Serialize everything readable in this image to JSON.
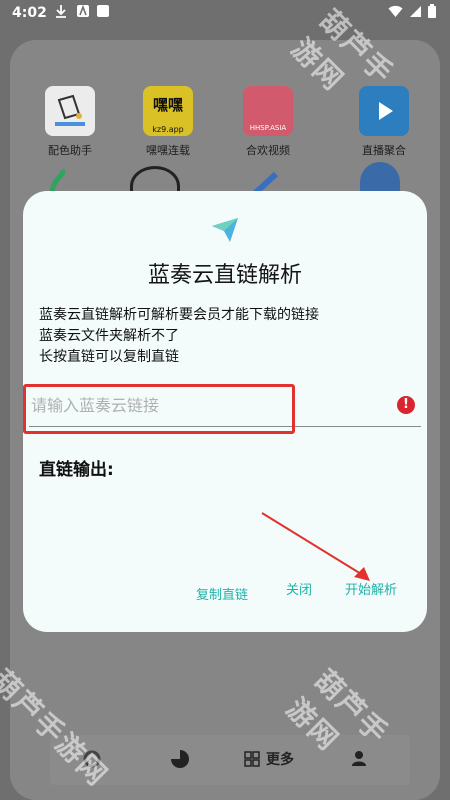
{
  "status": {
    "time": "4:02"
  },
  "apps_row1": [
    {
      "label": "配色助手",
      "color": "#efefef"
    },
    {
      "label": "嘿嘿连载",
      "color": "#d9c126",
      "inner": "嘿嘿",
      "sub": "kz9.app"
    },
    {
      "label": "合欢视频",
      "color": "#d25a6d",
      "sub": "HHSP.ASIA"
    },
    {
      "label": "直播聚合",
      "color": "#2c7ebf"
    }
  ],
  "dialog": {
    "title": "蓝奏云直链解析",
    "messages": [
      "蓝奏云直链解析可解析要会员才能下载的链接",
      "蓝奏云文件夹解析不了",
      "长按直链可以复制直链"
    ],
    "input": {
      "placeholder": "请输入蓝奏云链接",
      "value": ""
    },
    "error_icon": "!",
    "output_label": "直链输出:",
    "buttons": {
      "copy": "复制直链",
      "close": "关闭",
      "start": "开始解析"
    },
    "accent_color": "#22b2a8",
    "highlight_color": "#e2322f"
  },
  "bottom_nav": {
    "more_label": "更多"
  },
  "watermarks": [
    "葫芦手游网",
    "葫芦手游网",
    "葫芦手游网"
  ]
}
